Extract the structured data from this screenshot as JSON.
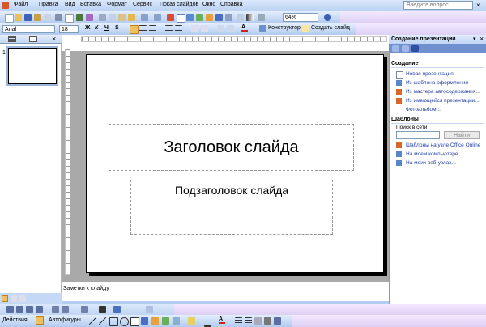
{
  "menu": {
    "items": [
      "Файл",
      "Правка",
      "Вид",
      "Вставка",
      "Формат",
      "Сервис",
      "Показ слайдов",
      "Окно",
      "Справка"
    ],
    "help_placeholder": "Введите вопрос",
    "close_glyph": "×"
  },
  "toolbar": {
    "zoom": "64%",
    "font": "Arial",
    "font_size": "18",
    "bold": "Ж",
    "italic": "К",
    "underline": "Ч",
    "shadow": "S",
    "designer_label": "Конструктор",
    "new_slide_label": "Создать слайд"
  },
  "slides_panel": {
    "slide_number": "1",
    "close_glyph": "×"
  },
  "slide": {
    "title": "Заголовок слайда",
    "subtitle": "Подзаголовок слайда"
  },
  "notes": {
    "label": "Заметки к слайду"
  },
  "task_pane": {
    "title": "Создание презентации",
    "create_section": "Создание",
    "create_links": [
      "Новая презентация",
      "Из шаблона оформления",
      "Из мастера автосодержания...",
      "Из имеющейся презентации...",
      "Фотоальбом..."
    ],
    "templates_section": "Шаблоны",
    "search_label": "Поиск в сети:",
    "search_button": "Найти",
    "template_links": [
      "Шаблоны на узле Office Online",
      "На моем компьютере...",
      "На моих веб-узлах..."
    ]
  },
  "drawing": {
    "actions_label": "Действия",
    "autoshapes_label": "Автофигуры"
  },
  "colors": {
    "accent": "#2642a8",
    "toolbar_blue": "#b2caf0",
    "workarea_gray": "#a9a9a9"
  }
}
